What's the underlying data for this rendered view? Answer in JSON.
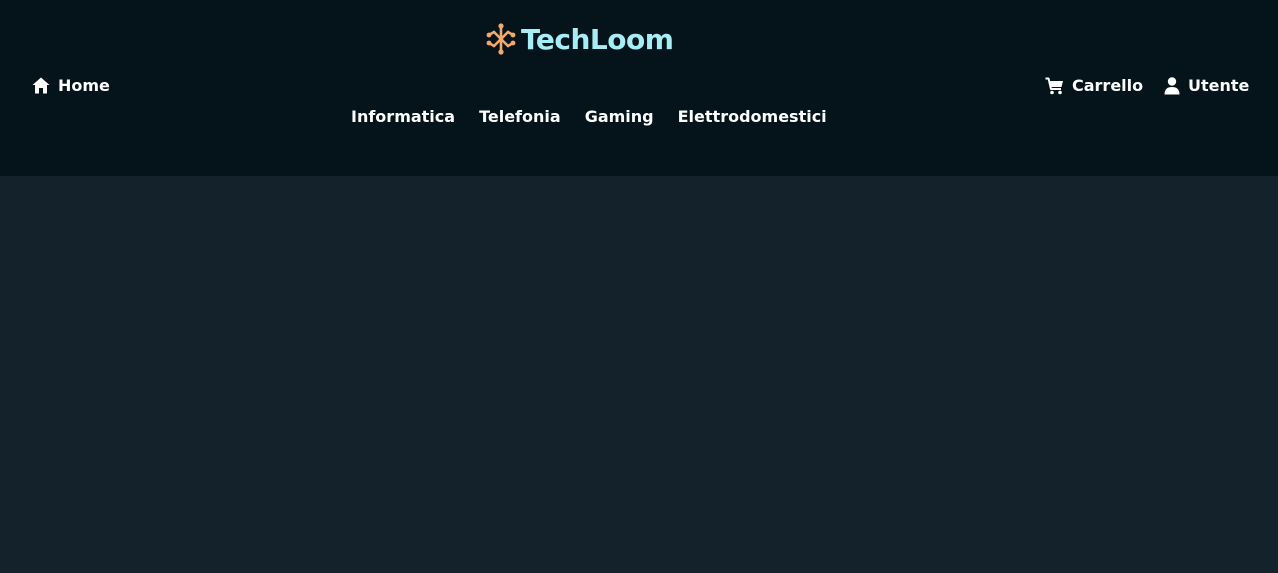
{
  "brand": {
    "name": "TechLoom",
    "icon": "network-logo-icon",
    "color": "#a6eef5",
    "icon_color": "#f2a96a"
  },
  "nav": {
    "home_label": "Home",
    "home_icon": "home-icon",
    "cart_label": "Carrello",
    "cart_icon": "cart-icon",
    "user_label": "Utente",
    "user_icon": "user-icon"
  },
  "categories": [
    "Informatica",
    "Telefonia",
    "Gaming",
    "Elettrodomestici"
  ],
  "colors": {
    "header_bg": "#05141a",
    "page_bg": "#14232b",
    "nav_text": "#ffffff"
  }
}
